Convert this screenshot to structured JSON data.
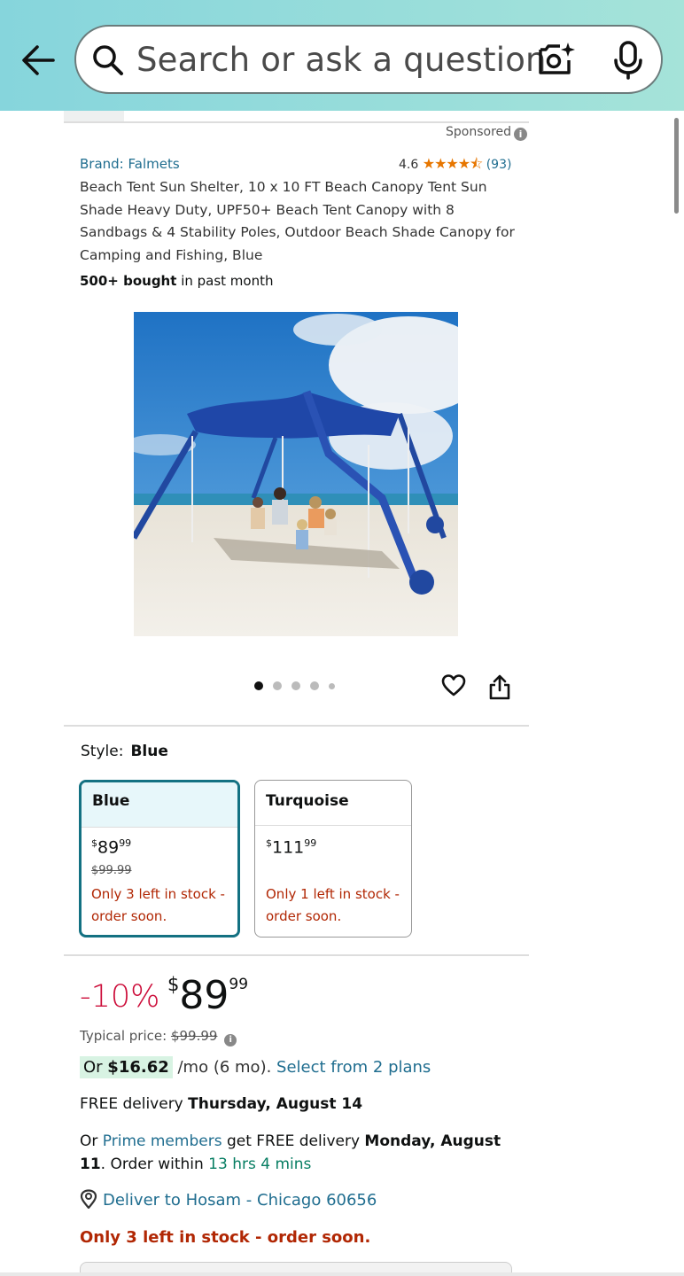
{
  "search": {
    "placeholder": "Search or ask a question"
  },
  "listing": {
    "sponsored_label": "Sponsored",
    "brand": "Brand: Falmets",
    "rating_value": "4.6",
    "rating_stars": "★★★★⯪",
    "rating_count": "(93)",
    "title": "Beach Tent Sun Shelter, 10 x 10 FT Beach Canopy Tent Sun Shade Heavy Duty, UPF50+ Beach Tent Canopy with 8 Sandbags & 4 Stability Poles, Outdoor Beach Shade Canopy for Camping and Fishing, Blue",
    "bought_bold": "500+ bought",
    "bought_rest": " in past month",
    "image_count": 5,
    "current_image": 1
  },
  "style": {
    "label": "Style:",
    "selected": "Blue",
    "options": [
      {
        "name": "Blue",
        "currency": "$",
        "whole": "89",
        "cents": "99",
        "strike": "$99.99",
        "stock": "Only 3 left in stock - order soon.",
        "selected": true
      },
      {
        "name": "Turquoise",
        "currency": "$",
        "whole": "111",
        "cents": "99",
        "strike": "",
        "stock": "Only 1 left in stock - order soon.",
        "selected": false
      }
    ]
  },
  "price": {
    "discount": "-10%",
    "currency": "$",
    "whole": "89",
    "cents": "99",
    "typical_label": "Typical price:",
    "typical_value": "$99.99"
  },
  "financing": {
    "prefix": "Or ",
    "amount": "$16.62",
    "term": " /mo (6 mo). ",
    "link": "Select from 2 plans"
  },
  "delivery": {
    "free_prefix": "FREE delivery ",
    "free_date": "Thursday, August 14",
    "prime_prefix": "Or ",
    "prime_link": "Prime members",
    "prime_mid": " get FREE delivery ",
    "prime_date": "Monday, August 11",
    "order_within": ". Order within ",
    "countdown": "13 hrs 4 mins",
    "deliver_to": "Deliver to Hosam - Chicago 60656",
    "stock_warning": "Only 3 left in stock - order soon."
  },
  "colors": {
    "header_gradient_start": "#86d5dc",
    "header_gradient_end": "#a5e3d9",
    "link": "#1f6d8f",
    "discount_red": "#cc0c39",
    "stock_red": "#b12704",
    "selected_border": "#137182",
    "star_orange": "#e77600",
    "countdown_green": "#067d62"
  }
}
